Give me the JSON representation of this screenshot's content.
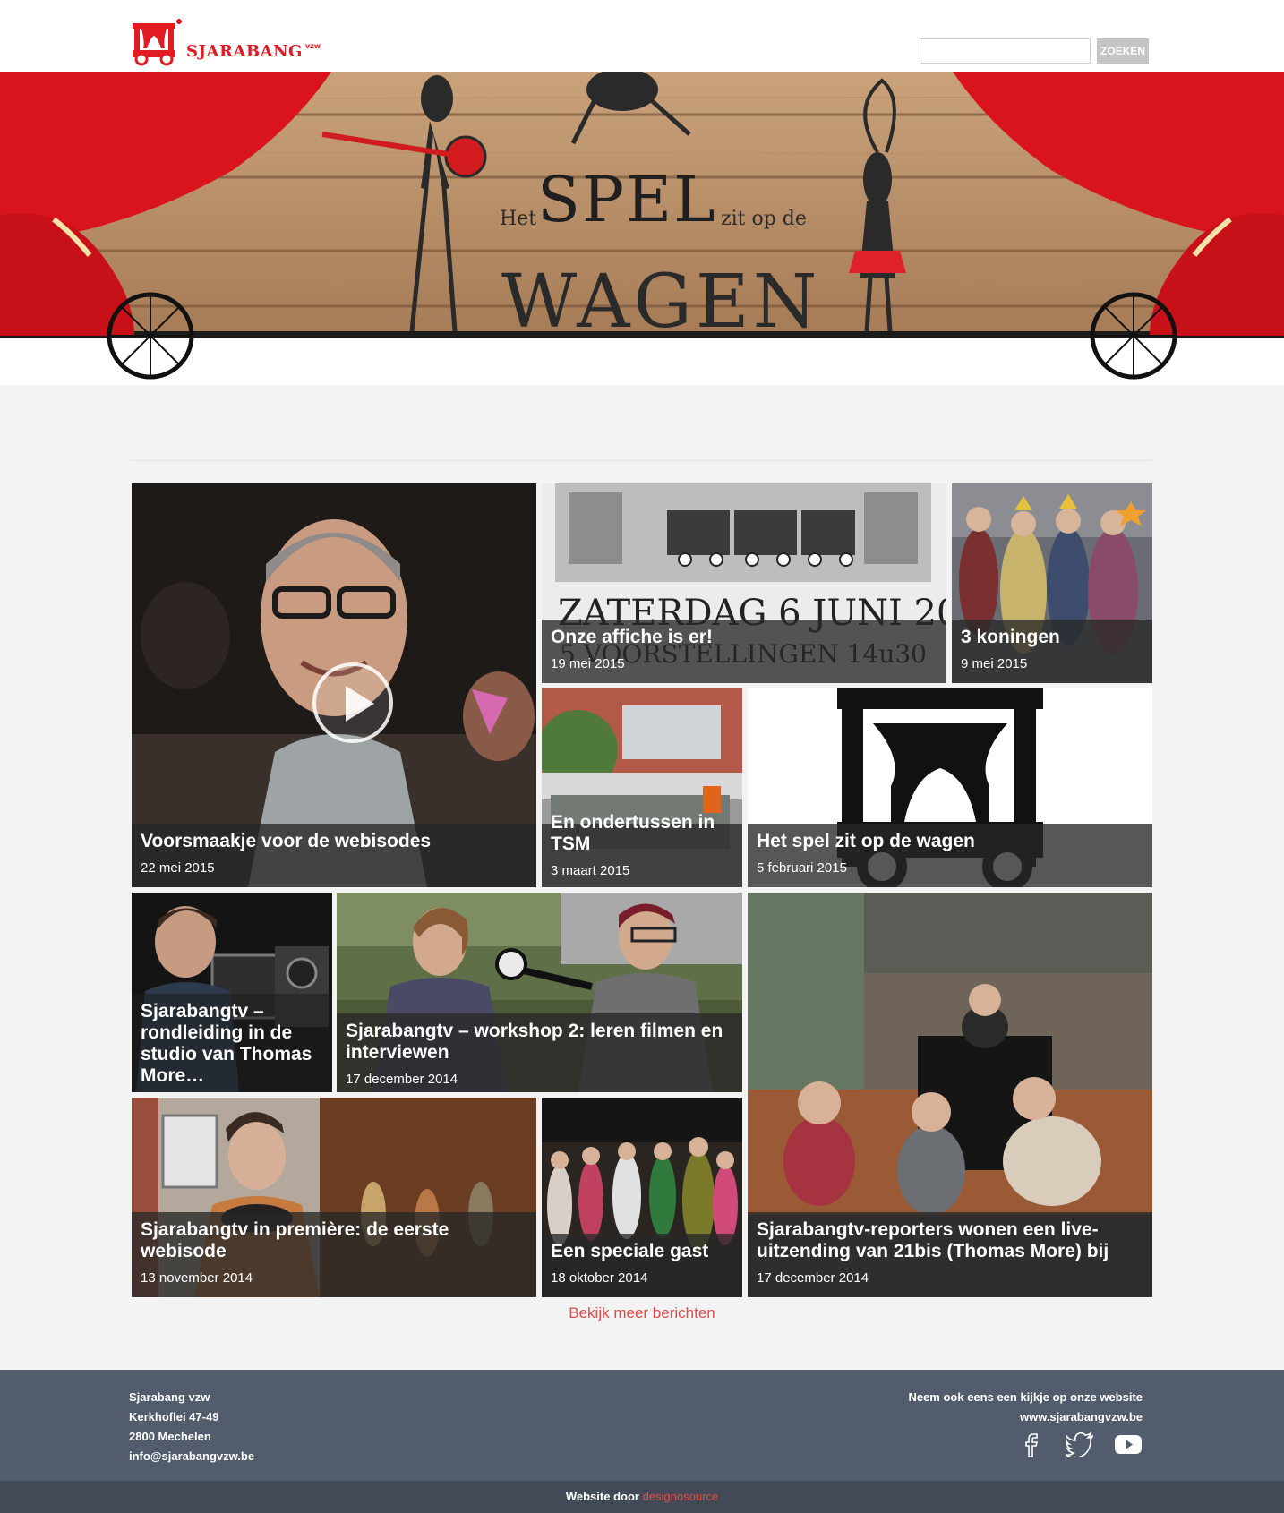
{
  "header": {
    "logo_text": "SJARABANG",
    "logo_suffix": "vzw",
    "search": {
      "value": "",
      "placeholder": ""
    },
    "search_button": "ZOEKEN"
  },
  "banner": {
    "word_het": "Het",
    "word_spel": "SPEL",
    "word_zit": "zit op de",
    "word_wagen": "WAGEN"
  },
  "posts": [
    {
      "title": "Voorsmaakje voor de webisodes",
      "date": "22 mei 2015",
      "video": true
    },
    {
      "title": "Onze affiche is er!",
      "date": "19 mei 2015"
    },
    {
      "title": "3 koningen",
      "date": "9 mei 2015"
    },
    {
      "title": "En ondertussen in TSM",
      "date": "3 maart 2015"
    },
    {
      "title": "Het spel zit op de wagen",
      "date": "5 februari 2015"
    },
    {
      "title": "Sjarabangtv – rondleiding in de studio van Thomas More…",
      "date": ""
    },
    {
      "title": "Sjarabangtv – workshop 2: leren filmen en interviewen",
      "date": "17 december 2014"
    },
    {
      "title": "Sjarabangtv-reporters wonen een live-uitzending van 21bis (Thomas More) bij",
      "date": "17 december 2014"
    },
    {
      "title": "Sjarabangtv in première: de eerste webisode",
      "date": "13 november 2014"
    },
    {
      "title": "Een speciale gast",
      "date": "18 oktober 2014"
    }
  ],
  "more_link": "Bekijk meer berichten",
  "footer": {
    "org": "Sjarabang vzw",
    "street": "Kerkhoflei 47-49",
    "city": "2800 Mechelen",
    "email": "info@sjarabangvzw.be",
    "cta": "Neem ook eens een kijkje op onze website",
    "site": "www.sjarabangvzw.be",
    "socials": [
      "facebook-icon",
      "twitter-icon",
      "youtube-icon"
    ]
  },
  "bottom": {
    "credit_prefix": "Website door",
    "credit_link": "designosource"
  },
  "colors": {
    "brand_red": "#e01b22",
    "footer_bg": "#525c6d",
    "bottom_bg": "#434a57",
    "link_red": "#e24a4a"
  }
}
